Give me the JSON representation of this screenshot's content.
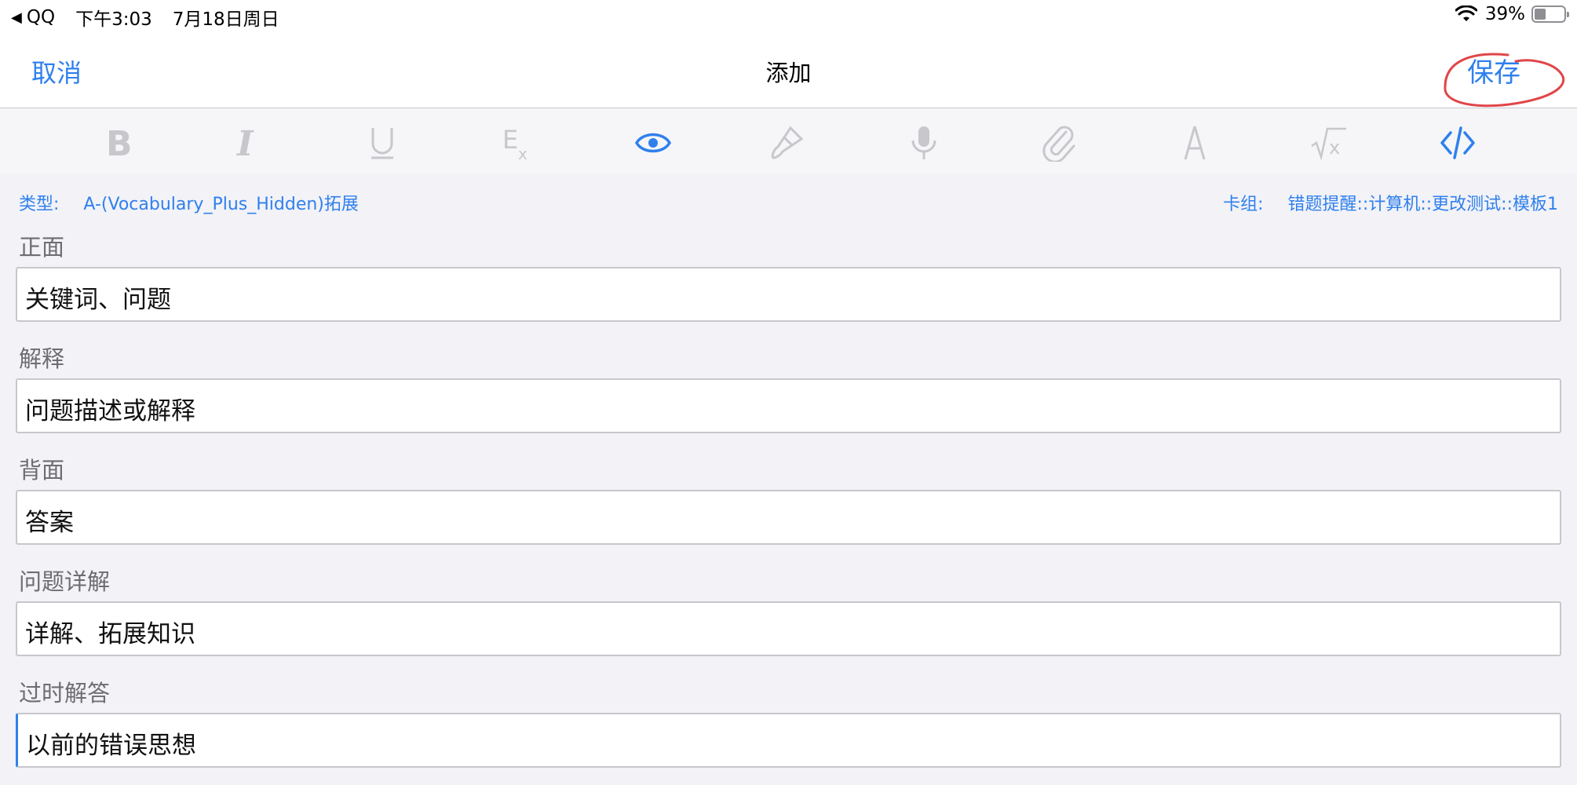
{
  "status": {
    "back_app": "QQ",
    "time": "下午3:03",
    "date": "7月18日周日",
    "battery": "39%"
  },
  "nav": {
    "cancel": "取消",
    "title": "添加",
    "save": "保存"
  },
  "toolbar": [
    {
      "name": "bold-icon",
      "active": false
    },
    {
      "name": "italic-icon",
      "active": false
    },
    {
      "name": "underline-icon",
      "active": false
    },
    {
      "name": "clear-format-icon",
      "active": false
    },
    {
      "name": "eye-icon",
      "active": true
    },
    {
      "name": "paint-brush-icon",
      "active": false
    },
    {
      "name": "microphone-icon",
      "active": false
    },
    {
      "name": "paperclip-icon",
      "active": false
    },
    {
      "name": "pen-icon",
      "active": false
    },
    {
      "name": "math-sqrt-icon",
      "active": false
    },
    {
      "name": "code-icon",
      "active": true
    }
  ],
  "meta": {
    "type_label": "类型:",
    "type_value": "A-(Vocabulary_Plus_Hidden)拓展",
    "deck_label": "卡组:",
    "deck_value": "错题提醒::计算机::更改测试::模板1"
  },
  "fields": [
    {
      "label": "正面",
      "value": "关键词、问题"
    },
    {
      "label": "解释",
      "value": "问题描述或解释"
    },
    {
      "label": "背面",
      "value": "答案"
    },
    {
      "label": "问题详解",
      "value": "详解、拓展知识"
    },
    {
      "label": "过时解答",
      "value": "以前的错误思想"
    }
  ],
  "colors": {
    "accent": "#2f80ed",
    "inactive_icon": "#c7c7cc",
    "annotation": "#e0464a"
  }
}
